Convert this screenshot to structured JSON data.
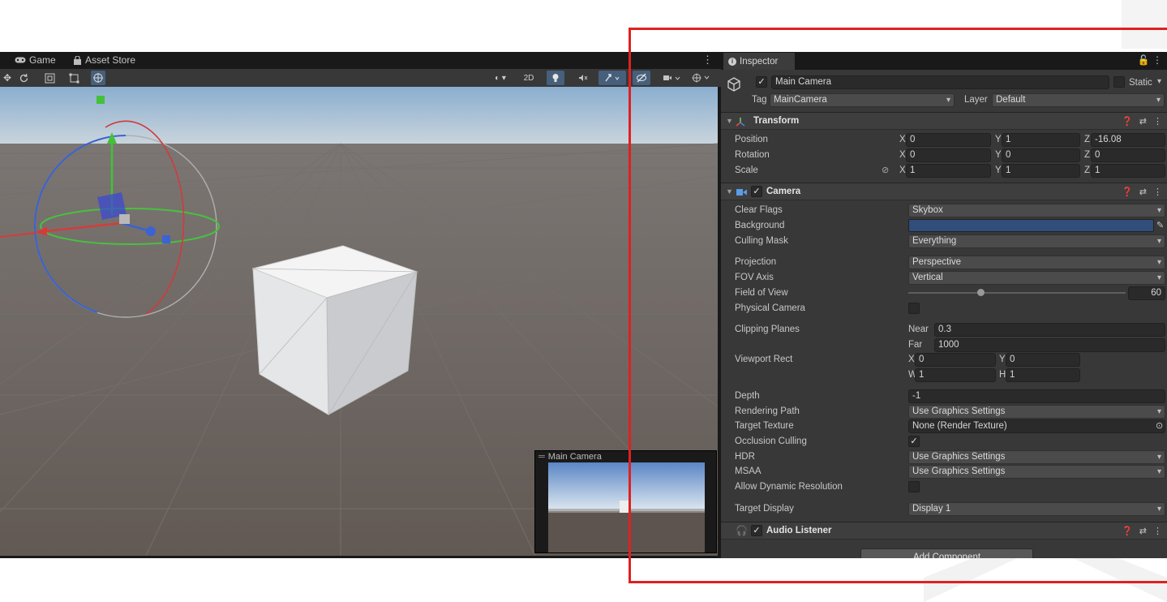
{
  "scene_tabs": {
    "game": "Game",
    "asset_store": "Asset Store"
  },
  "scene_toolbar": {
    "mode_2d": "2D"
  },
  "camera_preview": {
    "title": "Main Camera"
  },
  "inspector": {
    "tab_label": "Inspector",
    "object": {
      "name": "Main Camera",
      "static_label": "Static",
      "active": true,
      "tag_label": "Tag",
      "tag_value": "MainCamera",
      "layer_label": "Layer",
      "layer_value": "Default"
    },
    "transform": {
      "title": "Transform",
      "position_label": "Position",
      "rotation_label": "Rotation",
      "scale_label": "Scale",
      "position": {
        "x": "0",
        "y": "1",
        "z": "-16.08"
      },
      "rotation": {
        "x": "0",
        "y": "0",
        "z": "0"
      },
      "scale": {
        "x": "1",
        "y": "1",
        "z": "1"
      }
    },
    "camera": {
      "title": "Camera",
      "enabled": true,
      "clear_flags_label": "Clear Flags",
      "clear_flags": "Skybox",
      "background_label": "Background",
      "background_color": "#314d79",
      "culling_mask_label": "Culling Mask",
      "culling_mask": "Everything",
      "projection_label": "Projection",
      "projection": "Perspective",
      "fov_axis_label": "FOV Axis",
      "fov_axis": "Vertical",
      "fov_label": "Field of View",
      "fov_value": "60",
      "fov_min": 1,
      "fov_max": 179,
      "physical_camera_label": "Physical Camera",
      "clipping_planes_label": "Clipping Planes",
      "near_label": "Near",
      "near": "0.3",
      "far_label": "Far",
      "far": "1000",
      "viewport_rect_label": "Viewport Rect",
      "viewport": {
        "x": "0",
        "y": "0",
        "w": "1",
        "h": "1"
      },
      "depth_label": "Depth",
      "depth": "-1",
      "rendering_path_label": "Rendering Path",
      "rendering_path": "Use Graphics Settings",
      "target_texture_label": "Target Texture",
      "target_texture": "None (Render Texture)",
      "occlusion_culling_label": "Occlusion Culling",
      "occlusion_culling": true,
      "hdr_label": "HDR",
      "hdr": "Use Graphics Settings",
      "msaa_label": "MSAA",
      "msaa": "Use Graphics Settings",
      "allow_dynamic_resolution_label": "Allow Dynamic Resolution",
      "target_display_label": "Target Display",
      "target_display": "Display 1"
    },
    "audio_listener": {
      "title": "Audio Listener",
      "enabled": true
    },
    "add_component_label": "Add Component",
    "axis_labels": {
      "x": "X",
      "y": "Y",
      "z": "Z",
      "w": "W",
      "h": "H"
    }
  }
}
